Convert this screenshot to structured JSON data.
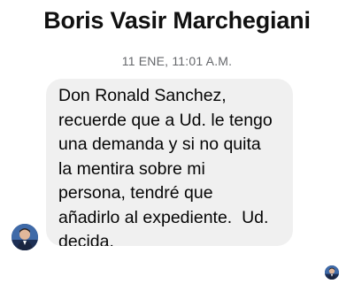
{
  "conversation": {
    "contact_name": "Boris Vasir Marchegiani",
    "timestamp": "11 ENE, 11:01 A.M."
  },
  "messages": [
    {
      "sender": "Boris Vasir Marchegiani",
      "text": "Don Ronald Sanchez,\nrecuerde que a Ud. le tengo\nuna demanda y si no quita\nla mentira sobre mi\npersona, tendré que\nañadirlo al expediente.  Ud.\ndecida.",
      "bubble_color": "#f0f0f0"
    }
  ],
  "icons": {
    "sender_avatar": "profile-photo-avatar",
    "seen_indicator": "seen-avatar-icon"
  },
  "colors": {
    "timestamp": "#65676b",
    "bubble": "#f0f0f0",
    "text": "#050505"
  }
}
